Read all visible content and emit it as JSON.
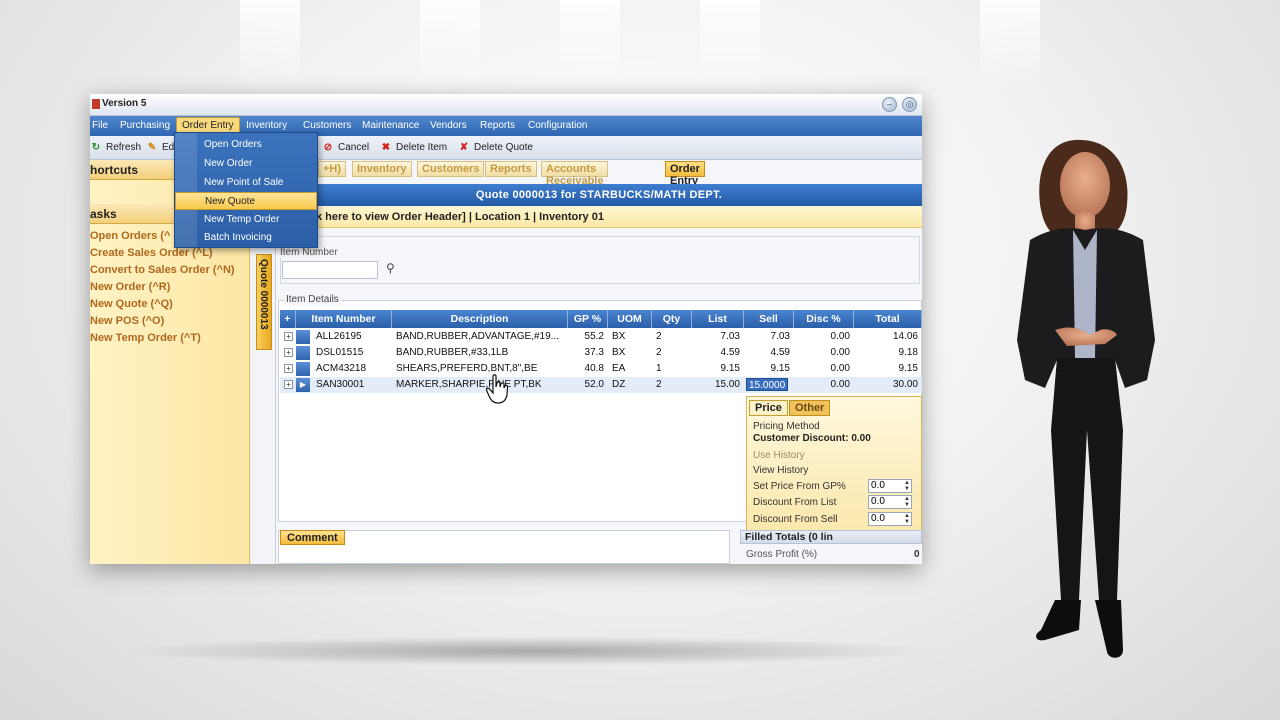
{
  "window": {
    "title": "Version 5"
  },
  "menubar": {
    "items": [
      "File",
      "Purchasing",
      "Order Entry",
      "Inventory",
      "Customers",
      "Maintenance",
      "Vendors",
      "Reports",
      "Configuration"
    ]
  },
  "order_entry_menu": {
    "items": [
      "Open Orders",
      "New Order",
      "New Point of Sale",
      "New Quote",
      "New Temp Order",
      "Batch Invoicing"
    ]
  },
  "toolbar": {
    "refresh": "Refresh",
    "edit": "Ed",
    "cancel": "Cancel",
    "delete_item": "Delete Item",
    "delete_quote": "Delete Quote"
  },
  "nav_tabs": [
    "+H)",
    "Inventory",
    "Customers",
    "Reports",
    "Accounts Receivable",
    "Order Entry"
  ],
  "sidebar": {
    "shortcuts_header": "hortcuts",
    "tasks_header": "asks",
    "tasks": [
      "Open Orders (^",
      "Create Sales Order (^L)",
      "Convert to Sales Order (^N)",
      "New Order (^R)",
      "New Quote (^Q)",
      "New POS (^O)",
      "New Temp Order (^T)"
    ]
  },
  "quote_tab_vertical": "Quote 0000013",
  "quote_banner": "Quote 0000013 for STARBUCKS/MATH DEPT.",
  "order_header_bar": "k here to view Order Header]  | Location 1    | Inventory 01",
  "item_section": {
    "legend_1": "m",
    "legend_2": "Item Number"
  },
  "item_details": {
    "legend": "Item Details",
    "columns": [
      "Item Number",
      "Description",
      "GP %",
      "UOM",
      "Qty",
      "List",
      "Sell",
      "Disc %",
      "Total"
    ],
    "rows": [
      [
        "ALL26195",
        "BAND,RUBBER,ADVANTAGE,#19...",
        "55.2",
        "BX",
        "2",
        "7.03",
        "7.03",
        "0.00",
        "14.06"
      ],
      [
        "DSL01515",
        "BAND,RUBBER,#33,1LB",
        "37.3",
        "BX",
        "2",
        "4.59",
        "4.59",
        "0.00",
        "9.18"
      ],
      [
        "ACM43218",
        "SHEARS,PREFERD,BNT,8\",BE",
        "40.8",
        "EA",
        "1",
        "9.15",
        "9.15",
        "0.00",
        "9.15"
      ],
      [
        "SAN30001",
        "MARKER,SHARPIE,FINE PT,BK",
        "52.0",
        "DZ",
        "2",
        "15.00",
        "15.0000",
        "0.00",
        "30.00"
      ]
    ]
  },
  "pricing_popup": {
    "tab_price": "Price",
    "tab_other": "Other",
    "pricing_method": "Pricing Method",
    "customer_discount": "Customer Discount: 0.00",
    "use_history": "Use History",
    "view_history": "View History",
    "set_price_gp": "Set Price From GP%",
    "discount_list": "Discount From List",
    "discount_sell": "Discount From Sell",
    "set_price_gp_value": "0.0",
    "discount_list_value": "0.0",
    "discount_sell_value": "0.0"
  },
  "comment_label": "Comment",
  "totals": {
    "header": "Filled Totals (0 lin",
    "gross_profit_label": "Gross Profit (%)",
    "gross_profit_value": "0"
  },
  "colors": {
    "menubar": "#2f66b2",
    "accent_gold": "#f3bc3c",
    "task_text": "#b0681d"
  }
}
